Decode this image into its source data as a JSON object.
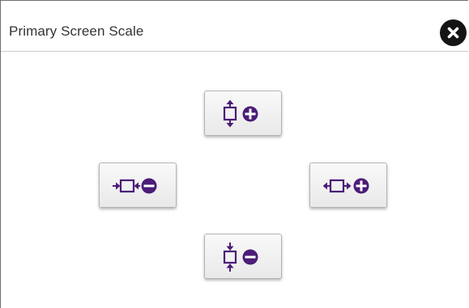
{
  "dialog": {
    "title": "Primary Screen Scale",
    "close_icon": "close-icon",
    "accent_color": "#4b1c78",
    "close_color": "#141414"
  },
  "buttons": [
    {
      "id": "vertical-increase",
      "icon": "expand-vertical-plus-icon"
    },
    {
      "id": "horizontal-decrease",
      "icon": "shrink-horizontal-minus-icon"
    },
    {
      "id": "horizontal-increase",
      "icon": "expand-horizontal-plus-icon"
    },
    {
      "id": "vertical-decrease",
      "icon": "shrink-vertical-minus-icon"
    }
  ]
}
